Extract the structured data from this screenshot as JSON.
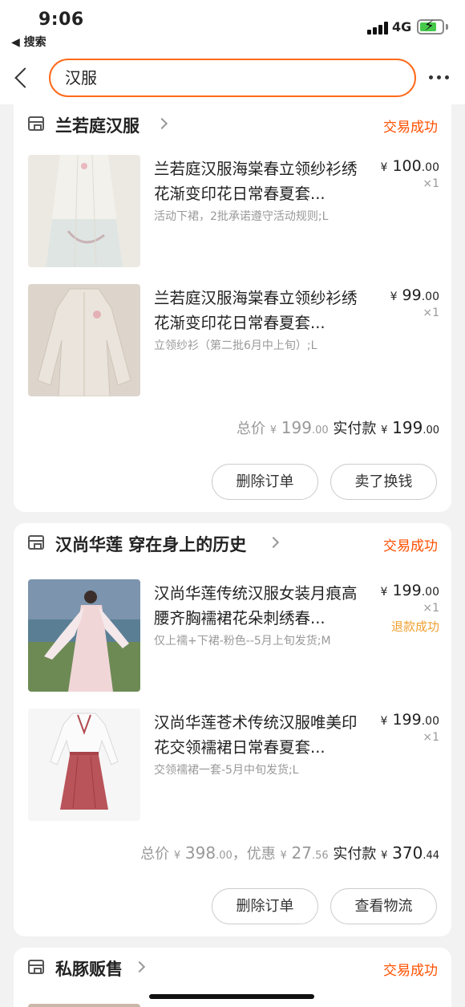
{
  "status_bar": {
    "time": "9:06",
    "back_app": "◀ 搜索",
    "network": "4G"
  },
  "nav": {
    "search_value": "汉服"
  },
  "orders": [
    {
      "shop": "兰若庭汉服",
      "status": "交易成功",
      "items": [
        {
          "title": "兰若庭汉服海棠春立领纱衫绣花渐变印花日常春夏套...",
          "sku": "活动下裙，2批承诺遵守活动规则;L",
          "price_yen": "¥",
          "price_int": "100",
          "price_dec": ".00",
          "qty": "×1"
        },
        {
          "title": "兰若庭汉服海棠春立领纱衫绣花渐变印花日常春夏套...",
          "sku": "立领纱衫（第二批6月中上旬）;L",
          "price_yen": "¥",
          "price_int": "99",
          "price_dec": ".00",
          "qty": "×1"
        }
      ],
      "total": {
        "label": "总价",
        "yen": "¥",
        "int": "199",
        "dec": ".00",
        "paid_label": "实付款",
        "paid_yen": "¥",
        "paid_int": "199",
        "paid_dec": ".00"
      },
      "buttons": [
        "删除订单",
        "卖了换钱"
      ]
    },
    {
      "shop": "汉尚华莲 穿在身上的历史",
      "status": "交易成功",
      "items": [
        {
          "title": "汉尚华莲传统汉服女装月痕高腰齐胸襦裙花朵刺绣春...",
          "sku": "仅上襦+下裙-粉色--5月上旬发货;M",
          "price_yen": "¥",
          "price_int": "199",
          "price_dec": ".00",
          "qty": "×1",
          "refund": "退款成功"
        },
        {
          "title": "汉尚华莲苍术传统汉服唯美印花交领襦裙日常春夏套...",
          "sku": "交领襦裙一套-5月中旬发货;L",
          "price_yen": "¥",
          "price_int": "199",
          "price_dec": ".00",
          "qty": "×1"
        }
      ],
      "total": {
        "label": "总价",
        "yen": "¥",
        "int": "398",
        "dec": ".00",
        "discount_label": "，优惠",
        "disc_yen": "¥",
        "disc_int": "27",
        "disc_dec": ".56",
        "paid_label": "实付款",
        "paid_yen": "¥",
        "paid_int": "370",
        "paid_dec": ".44"
      },
      "buttons": [
        "删除订单",
        "查看物流"
      ]
    },
    {
      "shop": "私豚贩售",
      "status": "交易成功"
    }
  ],
  "colors": {
    "accent": "#ff5000",
    "refund": "#f0a030",
    "search_border": "#ff6a1a",
    "background": "#f2f2f2"
  }
}
